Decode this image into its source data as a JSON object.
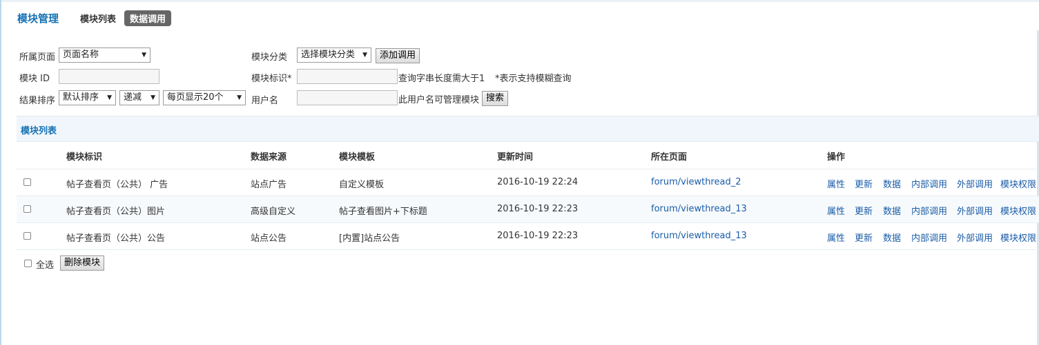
{
  "header": {
    "title": "模块管理",
    "tabs": [
      {
        "label": "模块列表",
        "active": false
      },
      {
        "label": "数据调用",
        "active": true
      }
    ]
  },
  "filters": {
    "page_label": "所属页面",
    "page_select": "页面名称",
    "category_label": "模块分类",
    "category_select": "选择模块分类",
    "add_button": "添加调用",
    "module_id_label": "模块 ID",
    "module_id_value": "",
    "module_tag_label": "模块标识*",
    "module_tag_value": "",
    "query_hint": "查询字串长度需大于1",
    "fuzzy_hint": "*表示支持模糊查询",
    "sort_label": "结果排序",
    "sort_select": "默认排序",
    "order_select": "递减",
    "perpage_select": "每页显示20个",
    "username_label": "用户名",
    "username_value": "",
    "username_hint": "此用户名可管理模块",
    "search_button": "搜索"
  },
  "list": {
    "title": "模块列表",
    "columns": [
      "模块标识",
      "数据来源",
      "模块模板",
      "更新时间",
      "所在页面",
      "操作"
    ],
    "rows": [
      {
        "tag": "帖子查看页（公共） 广告",
        "source": "站点广告",
        "template": "自定义模板",
        "updated": "2016-10-19 22:24",
        "page": "forum/viewthread_2"
      },
      {
        "tag": "帖子查看页（公共）图片",
        "source": "高级自定义",
        "template": "帖子查看图片+下标题",
        "updated": "2016-10-19 22:23",
        "page": "forum/viewthread_13"
      },
      {
        "tag": "帖子查看页（公共）公告",
        "source": "站点公告",
        "template": "[内置]站点公告",
        "updated": "2016-10-19 22:23",
        "page": "forum/viewthread_13"
      }
    ],
    "actions": [
      "属性",
      "更新",
      "数据",
      "内部调用",
      "外部调用",
      "模块权限"
    ],
    "select_all": "全选",
    "delete_button": "删除模块"
  },
  "colors": {
    "accent": "#1572b4",
    "link": "#1a5ca8",
    "tab_active_bg": "#666666"
  }
}
